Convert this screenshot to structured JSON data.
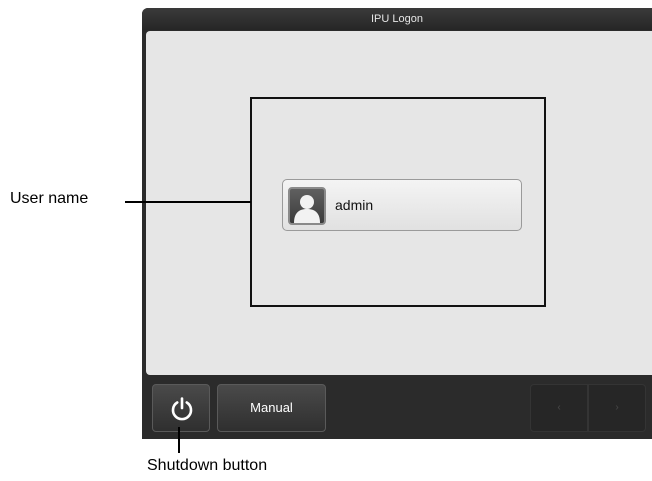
{
  "window": {
    "title": "IPU Logon"
  },
  "logon": {
    "user_label": "admin",
    "user_icon": "user-avatar-icon"
  },
  "toolbar": {
    "power_icon": "power-icon",
    "manual_label": "Manual",
    "prev_glyph": "‹",
    "next_glyph": "›"
  },
  "callouts": {
    "user_name": "User name",
    "shutdown_button": "Shutdown button"
  }
}
